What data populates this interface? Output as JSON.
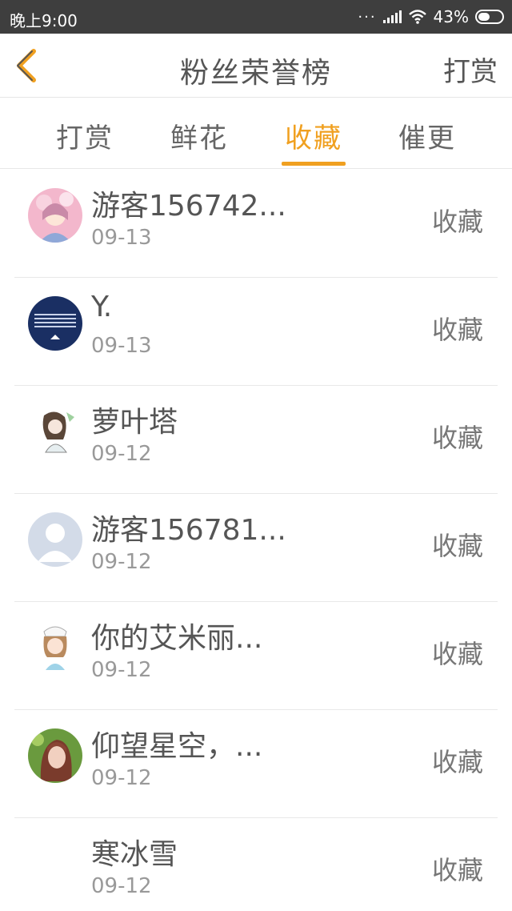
{
  "status_bar": {
    "time": "晚上9:00",
    "signal_dots": "···",
    "battery": "43%"
  },
  "header": {
    "title": "粉丝荣誉榜",
    "action": "打赏"
  },
  "tabs": [
    {
      "label": "打赏",
      "active": false
    },
    {
      "label": "鲜花",
      "active": false
    },
    {
      "label": "收藏",
      "active": true
    },
    {
      "label": "催更",
      "active": false
    }
  ],
  "colors": {
    "accent": "#f0a020",
    "status_bar": "#3e3e3e"
  },
  "fans": [
    {
      "name": "游客156742...",
      "date": "09-13",
      "action": "收藏",
      "avatar": "pink-anime-girl-avatar"
    },
    {
      "name": "Y.",
      "date": "09-13",
      "action": "收藏",
      "avatar": "navy-logo-avatar"
    },
    {
      "name": "萝叶塔",
      "date": "09-12",
      "action": "收藏",
      "avatar": "sketch-girl-avatar"
    },
    {
      "name": "游客156781...",
      "date": "09-12",
      "action": "收藏",
      "avatar": "default-user-avatar"
    },
    {
      "name": "你的艾米丽...",
      "date": "09-12",
      "action": "收藏",
      "avatar": "cartoon-chef-avatar"
    },
    {
      "name": "仰望星空，...",
      "date": "09-12",
      "action": "收藏",
      "avatar": "girl-photo-avatar"
    },
    {
      "name": "寒冰雪",
      "date": "09-12",
      "action": "收藏",
      "avatar": "none"
    }
  ]
}
